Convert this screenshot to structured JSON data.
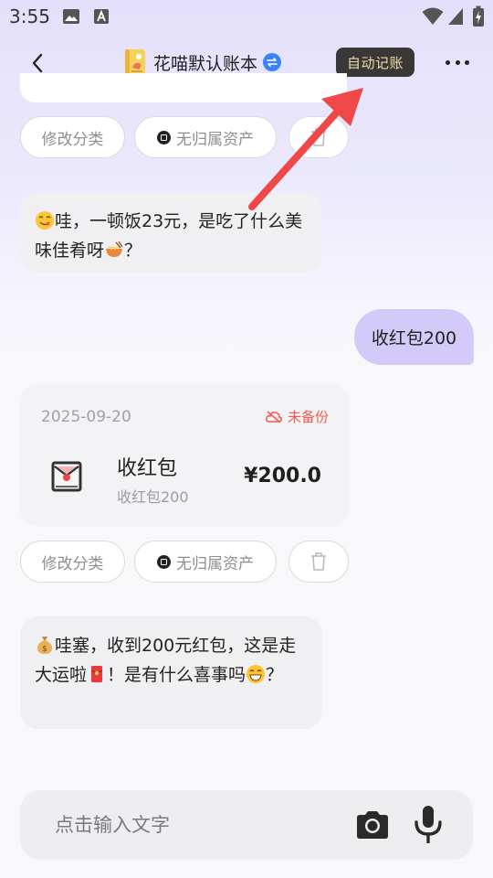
{
  "status_bar": {
    "time": "3:55"
  },
  "header": {
    "title": "花喵默认账本",
    "auto_record_label": "自动记账"
  },
  "entries": {
    "first_actions": {
      "change_category": "修改分类",
      "no_asset": "无归属资产"
    },
    "bot_reply_1": {
      "text": "哇，一顿饭23元，是吃了什么美味佳肴呀",
      "suffix": "？"
    },
    "user_message": {
      "text": "收红包200"
    },
    "record_card": {
      "date": "2025-09-20",
      "backup_status": "未备份",
      "title": "收红包",
      "subtitle": "收红包200",
      "amount": "¥200.0",
      "status_color": "#f25b4f"
    },
    "second_actions": {
      "change_category": "修改分类",
      "no_asset": "无归属资产"
    },
    "bot_reply_2": {
      "part1": "哇塞，收到200元红包，这是走大运啦",
      "part2": "！是有什么喜事吗",
      "suffix": "？"
    }
  },
  "input_bar": {
    "placeholder": "点击输入文字"
  },
  "icons": {
    "back": "chevron-left-icon",
    "book": "ledger-book-icon",
    "switch": "switch-book-icon",
    "more": "more-dots-icon",
    "wallet": "wallet-icon",
    "delete": "trash-icon",
    "cloud_off": "cloud-off-icon",
    "red_packet": "red-envelope-icon",
    "camera": "camera-icon",
    "mic": "microphone-icon"
  },
  "colors": {
    "accent_user_bubble": "#d3caf9",
    "auto_button_bg": "#3a3836",
    "auto_button_text": "#f1d9a7",
    "arrow": "#f04848"
  }
}
